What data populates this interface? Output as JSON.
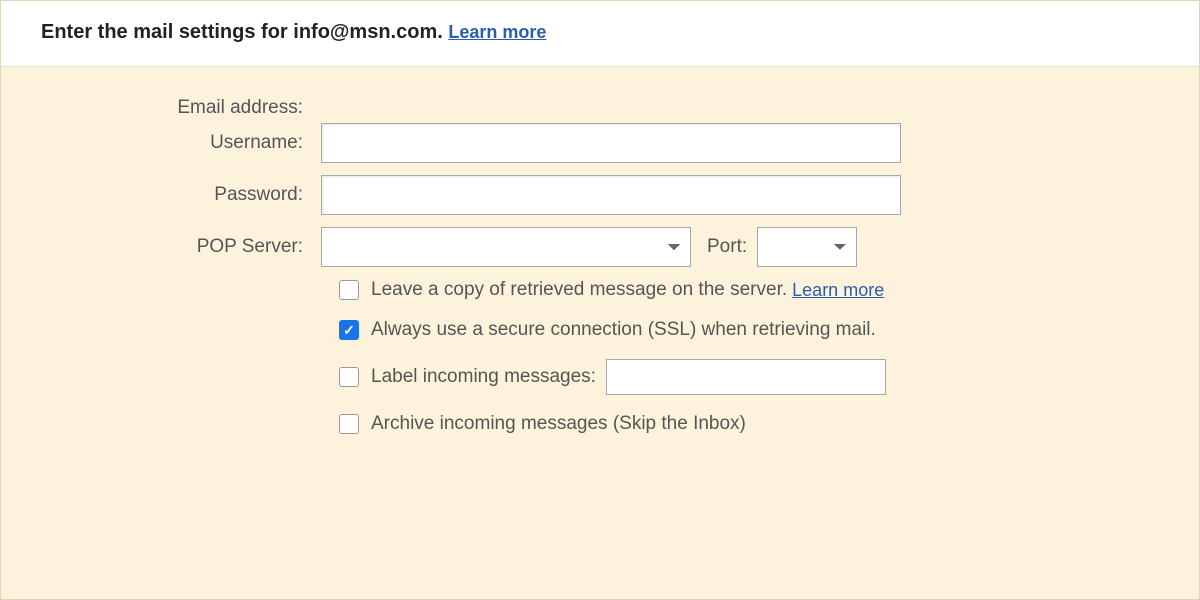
{
  "header": {
    "title_prefix": "Enter the mail settings for ",
    "email": "info@msn.com",
    "title_suffix": ". ",
    "learn_more": "Learn more"
  },
  "form": {
    "email_address_label": "Email address:",
    "username_label": "Username:",
    "username_value": "",
    "password_label": "Password:",
    "password_value": "",
    "pop_server_label": "POP Server:",
    "pop_server_value": "",
    "port_label": "Port:",
    "port_value": ""
  },
  "options": {
    "leave_copy": {
      "checked": false,
      "label": "Leave a copy of retrieved message on the server.",
      "learn_more": "Learn more"
    },
    "ssl": {
      "checked": true,
      "label": "Always use a secure connection (SSL) when retrieving mail."
    },
    "label_incoming": {
      "checked": false,
      "label": "Label incoming messages:",
      "select_value": ""
    },
    "archive": {
      "checked": false,
      "label": "Archive incoming messages (Skip the Inbox)"
    }
  }
}
